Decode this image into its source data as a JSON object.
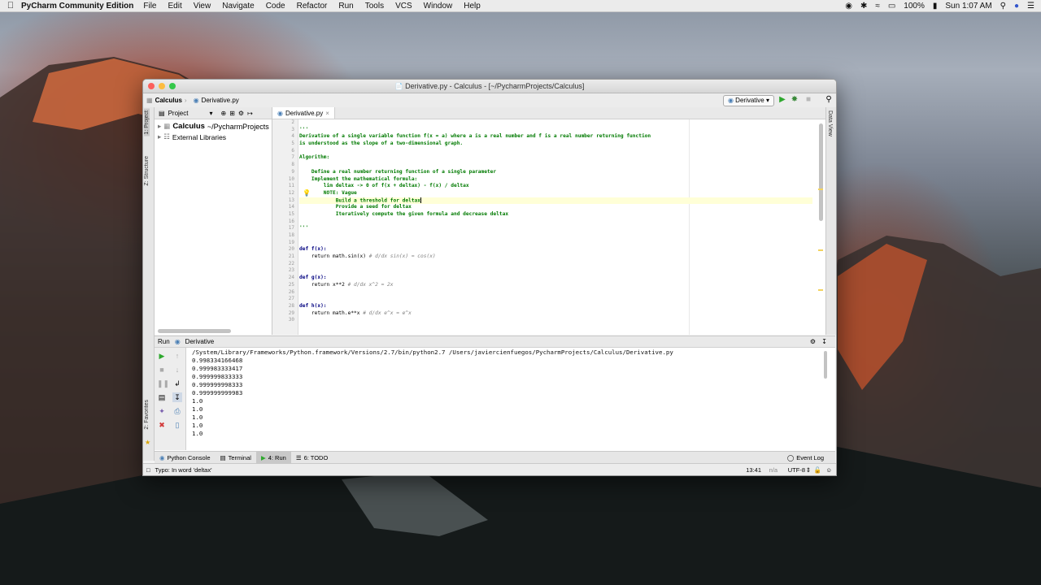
{
  "menubar": {
    "app_name": "PyCharm Community Edition",
    "items": [
      "File",
      "Edit",
      "View",
      "Navigate",
      "Code",
      "Refactor",
      "Run",
      "Tools",
      "VCS",
      "Window",
      "Help"
    ],
    "battery": "100%",
    "clock": "Sun 1:07 AM"
  },
  "window": {
    "title": "Derivative.py - Calculus - [~/PycharmProjects/Calculus]"
  },
  "navbar": {
    "crumb_project": "Calculus",
    "crumb_file": "Derivative.py",
    "run_config": "Derivative"
  },
  "side_tabs": {
    "project": "1: Project",
    "structure": "Z: Structure",
    "favorites": "2: Favorites",
    "data_view": "Data View"
  },
  "project_panel": {
    "header": "Project",
    "root_name": "Calculus",
    "root_path": "~/PycharmProjects",
    "ext_libs": "External Libraries"
  },
  "editor": {
    "tab_label": "Derivative.py",
    "line_numbers": [
      "2",
      "3",
      "4",
      "5",
      "6",
      "7",
      "8",
      "9",
      "10",
      "11",
      "12",
      "13",
      "14",
      "15",
      "16",
      "17",
      "18",
      "19",
      "20",
      "21",
      "22",
      "23",
      "24",
      "25",
      "26",
      "27",
      "28",
      "29",
      "30"
    ],
    "lines": [
      "",
      "'''",
      "Derivative of a single variable function f(x = a) where a is a real number and f is a real number returning function",
      "is understood as the slope of a two-dimensional graph.",
      "",
      "Algorithm:",
      "",
      "    Define a real number returning function of a single parameter",
      "    Implement the mathematical formula:",
      "        lim deltax -> 0 of f(x + deltax) - f(x) / deltax",
      "        NOTE: Vague",
      "            Build a threshold for deltax",
      "            Provide a seed for deltax",
      "            Iteratively compute the given formula and decrease deltax",
      "",
      "'''",
      "",
      "",
      "def f(x):",
      "    return math.sin(x) # d/dx sin(x) = cos(x)",
      "",
      "",
      "def g(x):",
      "    return x**2 # d/dx x^2 = 2x",
      "",
      "",
      "def h(x):",
      "    return math.e**x # d/dx e^x = e^x",
      ""
    ],
    "line21_code": "    return math.sin(x) ",
    "line21_comment": "# d/dx sin(x) = cos(x)",
    "line25_code": "    return x**2 ",
    "line25_comment": "# d/dx x^2 = 2x",
    "line29_code": "    return math.e**x ",
    "line29_comment": "# d/dx e^x = e^x"
  },
  "run_panel": {
    "label": "Run",
    "config": "Derivative",
    "output": [
      "/System/Library/Frameworks/Python.framework/Versions/2.7/bin/python2.7 /Users/javiercienfuegos/PycharmProjects/Calculus/Derivative.py",
      "0.998334166468",
      "0.999983333417",
      "0.999999833333",
      "0.999999998333",
      "0.999999999983",
      "1.0",
      "1.0",
      "1.0",
      "1.0",
      "1.0"
    ]
  },
  "bottom_tabs": {
    "python_console": "Python Console",
    "terminal": "Terminal",
    "run": "4: Run",
    "todo": "6: TODO",
    "event_log": "Event Log"
  },
  "statusbar": {
    "message": "Typo: In word 'deltax'",
    "position": "13:41",
    "na": "n/a",
    "encoding": "UTF-8"
  },
  "colors": {
    "docstring": "#007a00",
    "keyword": "#000080",
    "comment": "#808080",
    "run_green": "#2ea82e"
  }
}
